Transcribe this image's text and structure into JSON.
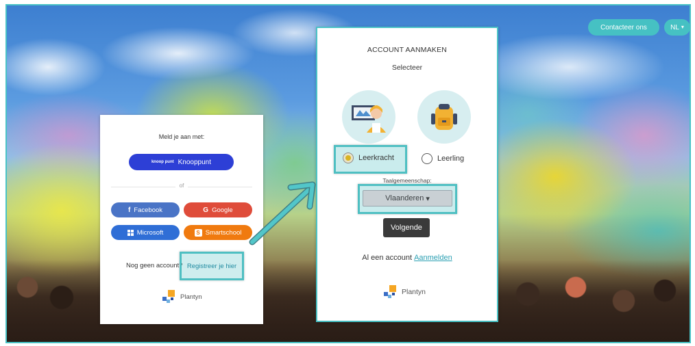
{
  "header": {
    "contact_label": "Contacteer ons",
    "language_label": "NL",
    "language_caret": "▾"
  },
  "login": {
    "title": "Meld je aan met:",
    "knooppunt_logo_text": "knoop punt",
    "knooppunt_label": "Knooppunt",
    "or_label": "of",
    "facebook_label": "Facebook",
    "google_label": "Google",
    "microsoft_label": "Microsoft",
    "smartschool_label": "Smartschool",
    "no_account_text": "Nog geen account?",
    "register_label": "Registreer je hier",
    "brand": "Plantyn"
  },
  "account": {
    "title": "ACCOUNT AANMAKEN",
    "subtitle": "Selecteer",
    "roles": [
      {
        "label": "Leerkracht",
        "selected": true
      },
      {
        "label": "Leerling",
        "selected": false
      }
    ],
    "language_community_label": "Taalgemeenschap:",
    "region_value": "Vlaanderen",
    "region_caret": "▾",
    "next_label": "Volgende",
    "already_text": "Al een account",
    "login_label": "Aanmelden",
    "brand": "Plantyn"
  },
  "colors": {
    "accent": "#49c3c6",
    "knooppunt": "#2d3fd6",
    "facebook": "#4a74c6",
    "google": "#df4c3a",
    "microsoft": "#2f6ed6",
    "smartschool": "#f07a0f"
  },
  "icons": {
    "facebook": "facebook-icon",
    "google": "google-icon",
    "microsoft": "microsoft-icon",
    "smartschool": "smartschool-icon",
    "teacher": "teacher-avatar",
    "student": "student-backpack-avatar",
    "arrow": "highlight-arrow"
  }
}
